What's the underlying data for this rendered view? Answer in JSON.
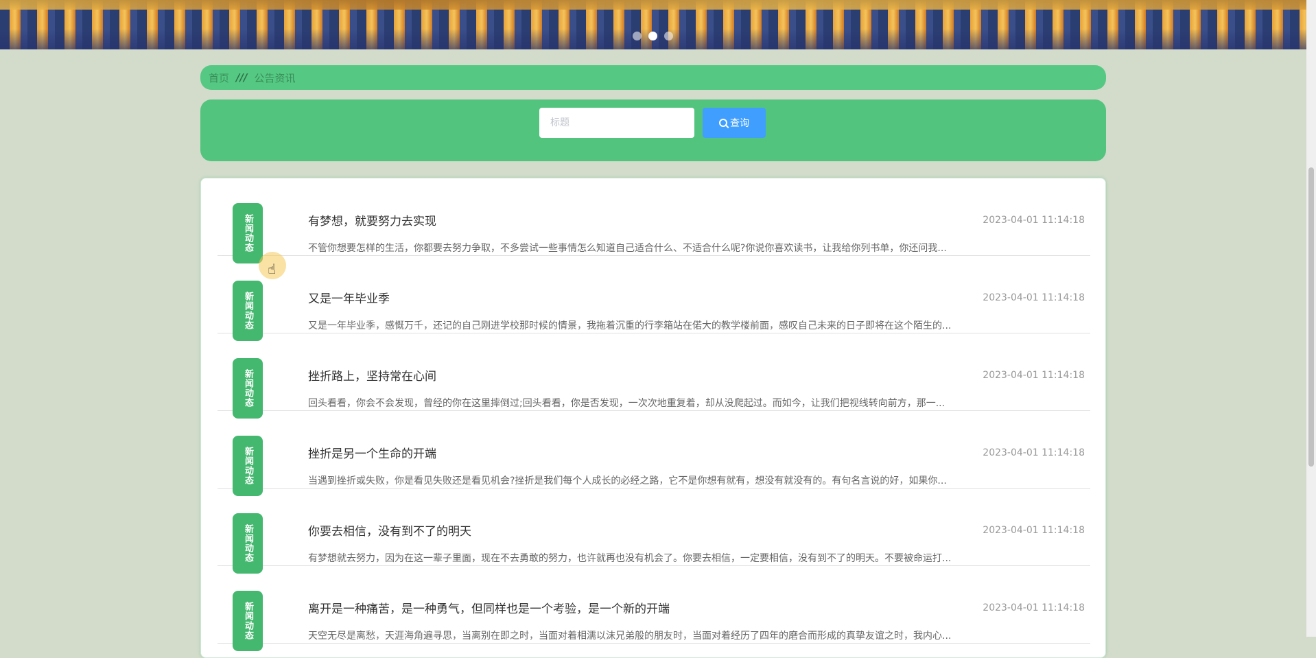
{
  "carousel": {
    "dots": 3,
    "active_index": 1
  },
  "breadcrumb": {
    "home": "首页",
    "separator": "///",
    "current": "公告资讯"
  },
  "search": {
    "placeholder": "标题",
    "button_label": "查询"
  },
  "news": {
    "tag_label": "新闻动态",
    "items": [
      {
        "title": "有梦想，就要努力去实现",
        "time": "2023-04-01 11:14:18",
        "summary": "不管你想要怎样的生活，你都要去努力争取，不多尝试一些事情怎么知道自己适合什么、不适合什么呢?你说你喜欢读书，让我给你列书单，你还问我..."
      },
      {
        "title": "又是一年毕业季",
        "time": "2023-04-01 11:14:18",
        "summary": "又是一年毕业季，感慨万千，还记的自己刚进学校那时候的情景，我拖着沉重的行李箱站在偌大的教学楼前面，感叹自己未来的日子即将在这个陌生的..."
      },
      {
        "title": "挫折路上，坚持常在心间",
        "time": "2023-04-01 11:14:18",
        "summary": "回头看看，你会不会发现，曾经的你在这里摔倒过;回头看看，你是否发现，一次次地重复着，却从没爬起过。而如今，让我们把视线转向前方，那一..."
      },
      {
        "title": "挫折是另一个生命的开端",
        "time": "2023-04-01 11:14:18",
        "summary": "当遇到挫折或失败，你是看见失败还是看见机会?挫折是我们每个人成长的必经之路，它不是你想有就有，想没有就没有的。有句名言说的好，如果你..."
      },
      {
        "title": "你要去相信，没有到不了的明天",
        "time": "2023-04-01 11:14:18",
        "summary": "有梦想就去努力，因为在这一辈子里面，现在不去勇敢的努力，也许就再也没有机会了。你要去相信，一定要相信，没有到不了的明天。不要被命运打..."
      },
      {
        "title": "离开是一种痛苦，是一种勇气，但同样也是一个考验，是一个新的开端",
        "time": "2023-04-01 11:14:18",
        "summary": "天空无尽是离愁，天涯海角遍寻思，当离别在即之时，当面对着相濡以沫兄弟般的朋友时，当面对着经历了四年的磨合而形成的真挚友谊之时，我内心..."
      }
    ]
  }
}
